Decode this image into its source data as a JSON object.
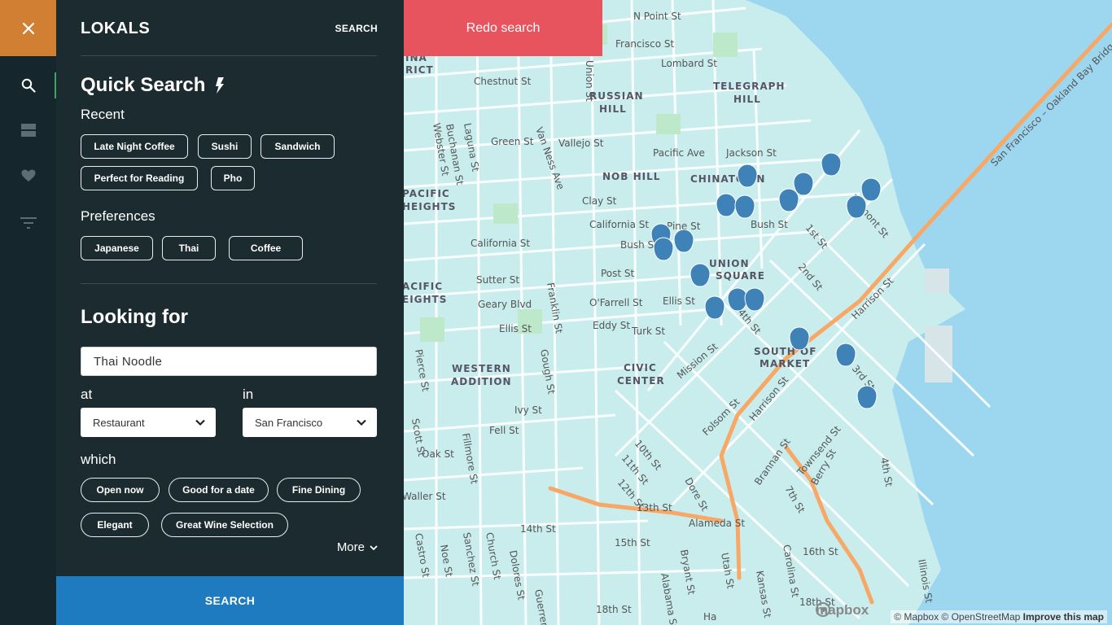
{
  "app": {
    "brand": "LOKALS",
    "top_search": "SEARCH"
  },
  "rail": {
    "items": [
      "close-icon",
      "search-icon",
      "list-icon",
      "heart-icon",
      "filter-icon"
    ]
  },
  "quick": {
    "title": "Quick Search",
    "recent_label": "Recent",
    "recent": [
      "Late Night Coffee",
      "Sushi",
      "Sandwich",
      "Perfect for Reading",
      "Pho"
    ],
    "preferences_label": "Preferences",
    "preferences": [
      "Japanese",
      "Thai",
      "Coffee"
    ]
  },
  "looking": {
    "title": "Looking for",
    "keyword": "Thai Noodle",
    "at_label": "at",
    "at_value": "Restaurant",
    "in_label": "in",
    "in_value": "San Francisco",
    "which_label": "which",
    "which": [
      "Open now",
      "Good for a date",
      "Fine Dining",
      "Elegant",
      "Great Wine Selection"
    ],
    "more": "More"
  },
  "search_button": "SEARCH",
  "map": {
    "redo": "Redo search",
    "attribution": "© Mapbox © OpenStreetMap",
    "improve": "Improve this map",
    "logo": "mapbox",
    "neighborhoods": [
      "RUSSIAN",
      "HILL",
      "TELEGRAPH",
      "HILL",
      "NOB HILL",
      "CHINATOWN",
      "UNION",
      "SQUARE",
      "SOUTH OF",
      "MARKET",
      "CIVIC",
      "CENTER",
      "WESTERN",
      "ADDITION",
      "PACIFIC",
      "HEIGHTS",
      "ACIFIC",
      "EIGHTS",
      "INA",
      "RICT"
    ],
    "streets": [
      "N Point St",
      "Francisco St",
      "Lombard St",
      "Chestnut St",
      "Union St",
      "Green St",
      "Vallejo St",
      "Jackson St",
      "Pacific Ave",
      "Clay St",
      "California St",
      "California St",
      "Pine St",
      "Bush St",
      "Bush St",
      "Post St",
      "Sutter St",
      "Geary Blvd",
      "O'Farrell St",
      "Ellis St",
      "Ellis St",
      "Eddy St",
      "Turk St",
      "Mission St",
      "Folsom St",
      "Harrison St",
      "Harrison St",
      "Brannan St",
      "Townsend St",
      "Berry St",
      "10th St",
      "11th St",
      "12th St",
      "13th St",
      "14th St",
      "15th St",
      "16th St",
      "18th St",
      "18th St",
      "Alameda St",
      "Van Ness Ave",
      "Franklin St",
      "Gough St",
      "Laguna St",
      "Buchanan St",
      "Webster St",
      "Pierce St",
      "Scott St",
      "Fillmore St",
      "Oak St",
      "Fell St",
      "Ivy St",
      "Waller St",
      "Castro St",
      "Noe St",
      "Sanchez St",
      "Church St",
      "Dolores St",
      "Guerrero St",
      "Bryant St",
      "Alabama St",
      "Utah St",
      "Kansas St",
      "Carolina St",
      "Dore St",
      "7th St",
      "4th St",
      "1st St",
      "2nd St",
      "3rd St",
      "4th St",
      "Illinois St",
      "Fremont St",
      "San Francisco – Oakland Bay Bridge",
      "Ha"
    ]
  },
  "colors": {
    "accent": "#d17f33",
    "primary": "#1e7bc0",
    "redo": "#e8545e",
    "marker": "#3f82b8",
    "freeway": "#f7a866"
  }
}
